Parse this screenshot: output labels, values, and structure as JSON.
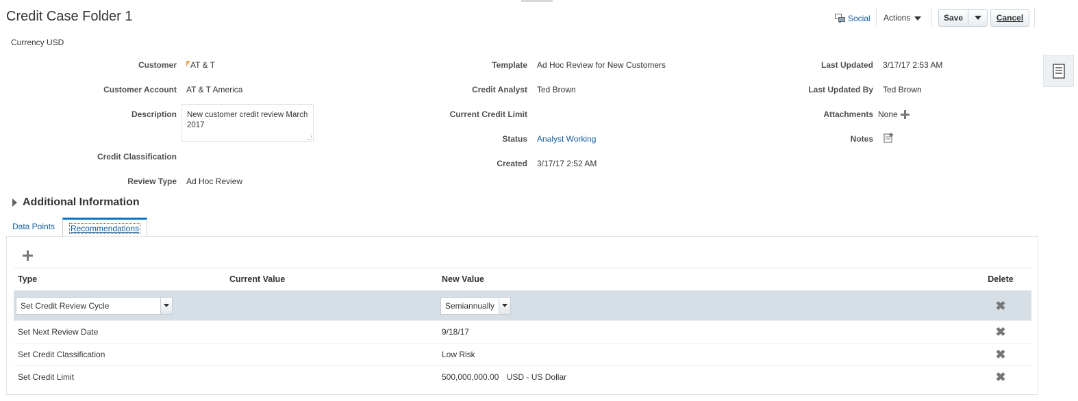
{
  "page": {
    "title": "Credit Case Folder 1",
    "currency_label": "Currency USD"
  },
  "toolbar": {
    "social_label": "Social",
    "actions_label": "Actions",
    "save_label": "Save",
    "cancel_label": "Cancel"
  },
  "form": {
    "customer_label": "Customer",
    "customer_value": "AT & T",
    "customer_account_label": "Customer Account",
    "customer_account_value": "AT & T America",
    "description_label": "Description",
    "description_value": "New customer credit review March 2017",
    "credit_classification_label": "Credit Classification",
    "credit_classification_value": "",
    "review_type_label": "Review Type",
    "review_type_value": "Ad Hoc Review",
    "template_label": "Template",
    "template_value": "Ad Hoc Review for New Customers",
    "credit_analyst_label": "Credit Analyst",
    "credit_analyst_value": "Ted Brown",
    "current_credit_limit_label": "Current Credit Limit",
    "current_credit_limit_value": "",
    "status_label": "Status",
    "status_value": "Analyst Working",
    "created_label": "Created",
    "created_value": "3/17/17 2:52 AM",
    "last_updated_label": "Last Updated",
    "last_updated_value": "3/17/17 2:53 AM",
    "last_updated_by_label": "Last Updated By",
    "last_updated_by_value": "Ted Brown",
    "attachments_label": "Attachments",
    "attachments_value": "None",
    "notes_label": "Notes"
  },
  "additional_information_label": "Additional Information",
  "tabs": [
    {
      "label": "Data Points",
      "active": false
    },
    {
      "label": "Recommendations",
      "active": true
    }
  ],
  "table": {
    "columns": [
      "Type",
      "Current Value",
      "New Value",
      "Delete"
    ],
    "rows": [
      {
        "type": "Set Credit Review Cycle",
        "current_value": "",
        "new_value": "Semiannually",
        "editable": true
      },
      {
        "type": "Set Next Review Date",
        "current_value": "",
        "new_value": "9/18/17"
      },
      {
        "type": "Set Credit Classification",
        "current_value": "",
        "new_value": "Low Risk"
      },
      {
        "type": "Set Credit Limit",
        "current_value": "",
        "new_value": "500,000,000.00",
        "currency": "USD - US Dollar"
      }
    ]
  },
  "colors": {
    "link": "#145c9e",
    "selected_row": "#d6dfe6",
    "active_tab_border": "#0572ce"
  },
  "icons": [
    "social-icon",
    "chevron-down-icon",
    "side-panel-icon",
    "plus-icon",
    "notes-icon",
    "delete-icon"
  ]
}
